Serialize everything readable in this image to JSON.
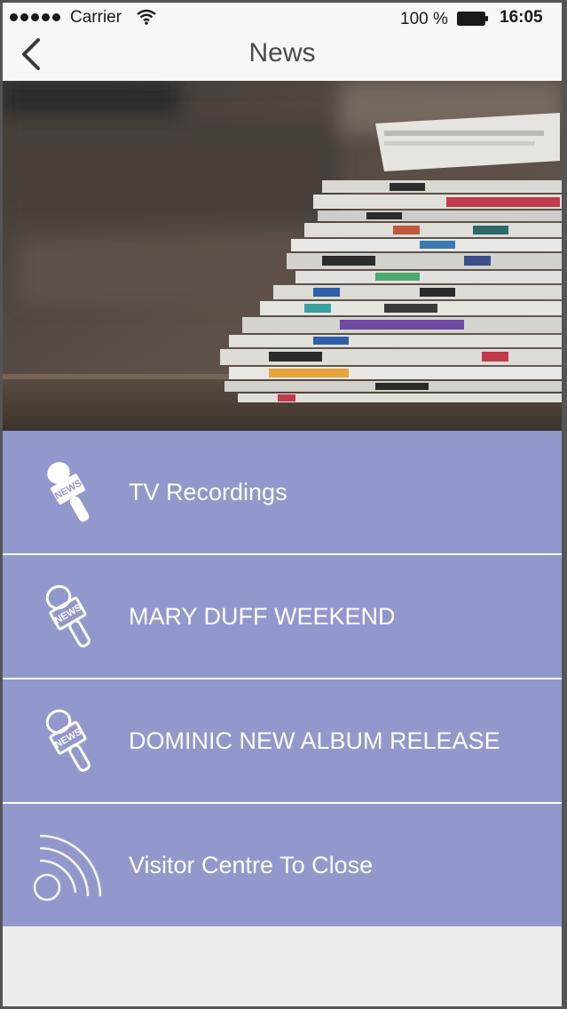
{
  "status_bar": {
    "carrier": "Carrier",
    "battery": "100 %",
    "time": "16:05"
  },
  "nav": {
    "title": "News"
  },
  "hero": {
    "icon": "newspaper-stack-photo"
  },
  "list": {
    "items": [
      {
        "label": "TV Recordings",
        "icon": "news-microphone-icon"
      },
      {
        "label": "MARY DUFF WEEKEND",
        "icon": "news-microphone-icon"
      },
      {
        "label": "DOMINIC NEW ALBUM RELEASE",
        "icon": "news-microphone-icon"
      },
      {
        "label": "Visitor Centre To Close",
        "icon": "rss-feed-icon"
      }
    ]
  },
  "colors": {
    "list_background": "#9398cc",
    "list_text": "#ffffff",
    "nav_background": "#f7f7f7",
    "page_background": "#ececec"
  }
}
